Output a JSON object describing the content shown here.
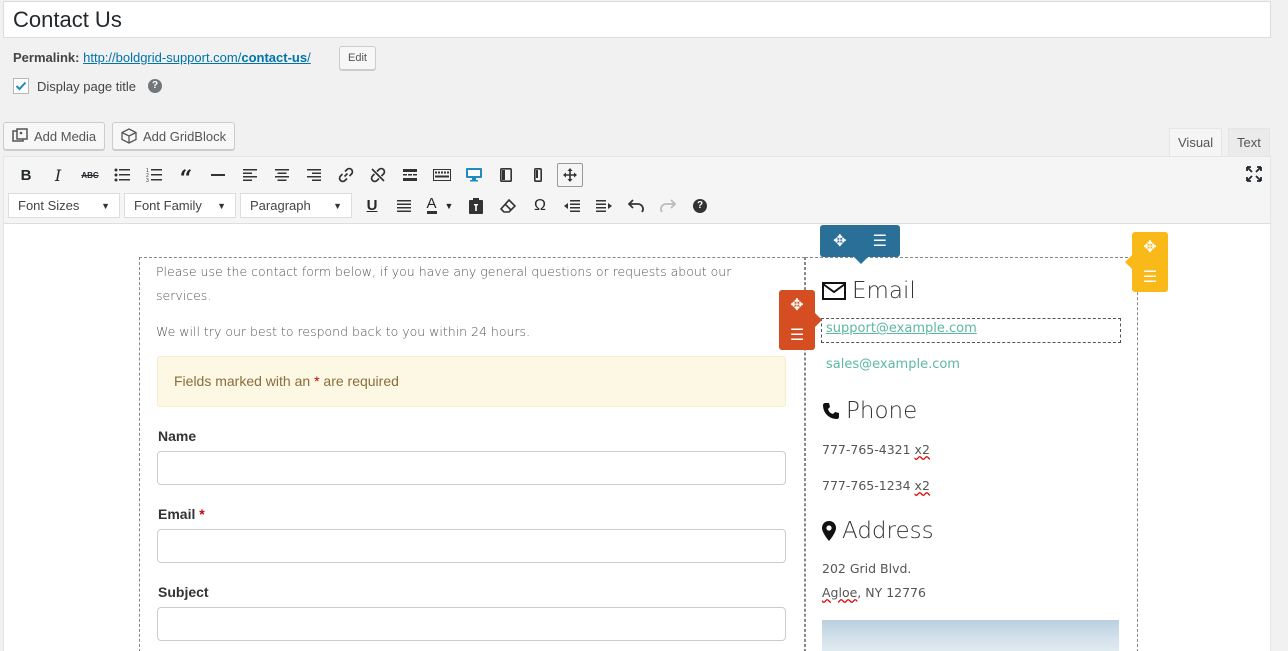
{
  "post": {
    "title": "Contact Us",
    "permalink_label": "Permalink:",
    "permalink_base": "http://boldgrid-support.com/",
    "permalink_slug": "contact-us",
    "permalink_trail": "/",
    "edit_label": "Edit",
    "display_title_label": "Display page title",
    "display_title_checked": true
  },
  "media_buttons": {
    "add_media": "Add Media",
    "add_gridblock": "Add GridBlock"
  },
  "editor_tabs": [
    "Visual",
    "Text"
  ],
  "toolbar": {
    "row1_icons": [
      "bold-icon",
      "italic-icon",
      "strikethrough-icon",
      "bulleted-list-icon",
      "numbered-list-icon",
      "blockquote-icon",
      "horizontal-line-icon",
      "align-left-icon",
      "align-center-icon",
      "align-right-icon",
      "link-icon",
      "unlink-icon",
      "read-more-icon",
      "toolbar-toggle-icon",
      "desktop-preview-icon",
      "tablet-preview-icon",
      "phone-preview-icon",
      "drag-move-icon"
    ],
    "font_sizes": "Font Sizes",
    "font_family": "Font Family",
    "paragraph": "Paragraph"
  },
  "content": {
    "intro": "Please use the contact form below, if you have any general questions or requests about our",
    "intro_cont": "services.",
    "respond": "We will try our best to respond back to you within 24 hours.",
    "notice_pre": "Fields marked with an",
    "notice_star": "*",
    "notice_post": "are required",
    "fields": [
      {
        "label": "Name",
        "required": false
      },
      {
        "label": "Email",
        "required": true
      },
      {
        "label": "Subject",
        "required": false
      }
    ],
    "required_mark": "*"
  },
  "sidebar": {
    "email_heading": "Email",
    "email_1": "support@example.com",
    "email_2": "sales@example.com",
    "phone_heading": "Phone",
    "phone_1": "777-765-4321",
    "phone_1_ext": "x2",
    "phone_2": "777-765-1234",
    "phone_2_ext": "x2",
    "address_heading": "Address",
    "address_line1": "202 Grid Blvd.",
    "address_city": "Agloe",
    "address_rest": ", NY 12776"
  },
  "colors": {
    "blue_hud": "#2a6f97",
    "orange_hud": "#d54e21",
    "yellow_hud": "#f9b918",
    "link": "#5cb8a2"
  }
}
